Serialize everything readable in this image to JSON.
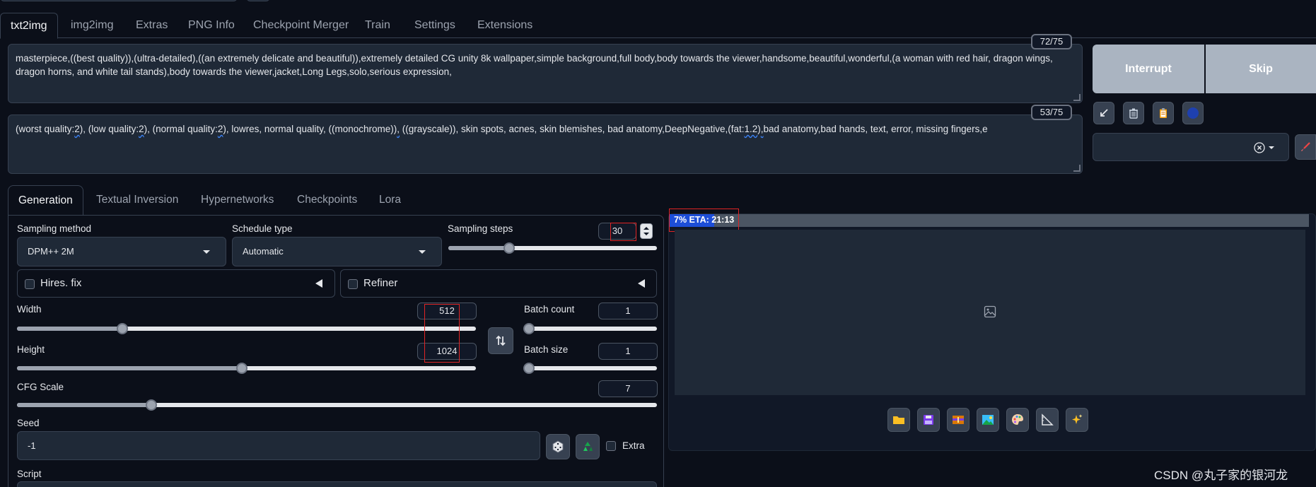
{
  "main_tabs": [
    "txt2img",
    "img2img",
    "Extras",
    "PNG Info",
    "Checkpoint Merger",
    "Train",
    "Settings",
    "Extensions"
  ],
  "prompt": {
    "text": "masterpiece,((best quality)),(ultra-detailed),((an extremely delicate and beautiful)),extremely detailed CG unity 8k wallpaper,simple background,full body,body towards the viewer,handsome,beautiful,wonderful,(a woman with red hair, dragon wings, dragon horns, and white tail stands),body towards the viewer,jacket,Long Legs,solo,serious expression,",
    "token_count": "72/75"
  },
  "negative_prompt": {
    "parts": [
      "(worst quality:",
      "2",
      "), (low quality:",
      "2",
      "), (normal quality:",
      "2",
      "), lowres, normal quality, ((monochrome))",
      ",",
      " ((grayscale)), skin spots, acnes, skin blemishes, bad anatomy,DeepNegative,(fat:",
      "1.2",
      ")",
      ",",
      "bad anatomy,bad hands, text, error, missing fingers,e"
    ],
    "token_count": "53/75"
  },
  "actions": {
    "interrupt_label": "Interrupt",
    "skip_label": "Skip"
  },
  "tool_icons": [
    "arrow-icon",
    "trash-icon",
    "clipboard-icon",
    "style-dot-icon"
  ],
  "sub_tabs": [
    "Generation",
    "Textual Inversion",
    "Hypernetworks",
    "Checkpoints",
    "Lora"
  ],
  "generation": {
    "sampling_method_label": "Sampling method",
    "sampling_method_value": "DPM++ 2M",
    "schedule_type_label": "Schedule type",
    "schedule_type_value": "Automatic",
    "sampling_steps_label": "Sampling steps",
    "sampling_steps_value": "30",
    "sampling_steps_fraction": 0.29,
    "hires_label": "Hires. fix",
    "refiner_label": "Refiner",
    "width_label": "Width",
    "width_value": "512",
    "width_fraction": 0.23,
    "height_label": "Height",
    "height_value": "1024",
    "height_fraction": 0.49,
    "batch_count_label": "Batch count",
    "batch_count_value": "1",
    "batch_size_label": "Batch size",
    "batch_size_value": "1",
    "cfg_label": "CFG Scale",
    "cfg_value": "7",
    "cfg_fraction": 0.21,
    "seed_label": "Seed",
    "seed_value": "-1",
    "extra_label": "Extra",
    "script_label": "Script"
  },
  "output": {
    "progress_text": "7% ETA: 21:13",
    "progress_percent": 7,
    "buttons": [
      "folder-icon",
      "save-icon",
      "zip-icon",
      "image-icon",
      "palette-icon",
      "ruler-icon",
      "sparkles-icon"
    ]
  },
  "watermark": "CSDN @丸子家的银河龙",
  "colors": {
    "background": "#0b0f19",
    "progress": "#1d4ed8",
    "highlight": "#e02424"
  }
}
